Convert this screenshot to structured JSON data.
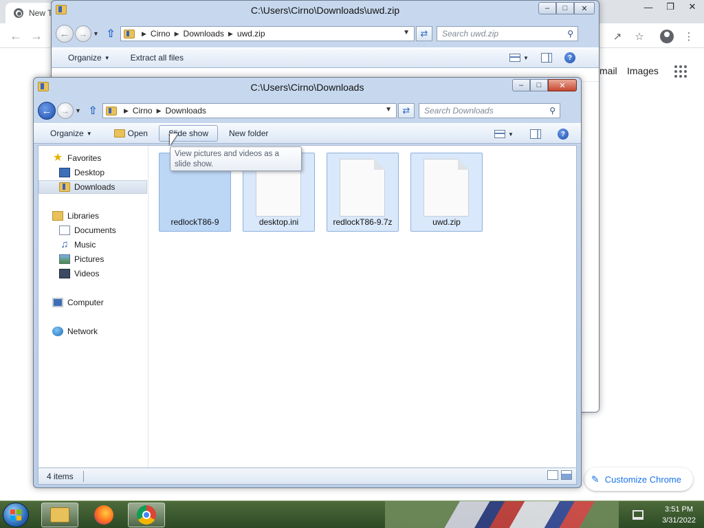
{
  "chrome": {
    "tab_title": "New T",
    "links": [
      "mail",
      "Images"
    ],
    "customize_label": "Customize Chrome"
  },
  "back_window": {
    "title": "C:\\Users\\Cirno\\Downloads\\uwd.zip",
    "breadcrumb": [
      "Cirno",
      "Downloads",
      "uwd.zip"
    ],
    "search_placeholder": "Search uwd.zip",
    "commands": {
      "organize": "Organize",
      "extract": "Extract all files"
    }
  },
  "front_window": {
    "title": "C:\\Users\\Cirno\\Downloads",
    "breadcrumb": [
      "Cirno",
      "Downloads"
    ],
    "search_placeholder": "Search Downloads",
    "commands": {
      "organize": "Organize",
      "open": "Open",
      "slideshow": "Slide show",
      "new_folder": "New folder"
    },
    "nav": {
      "favorites": "Favorites",
      "desktop": "Desktop",
      "downloads": "Downloads",
      "libraries": "Libraries",
      "documents": "Documents",
      "music": "Music",
      "pictures": "Pictures",
      "videos": "Videos",
      "computer": "Computer",
      "network": "Network"
    },
    "files": [
      "redlockT86-9",
      "desktop.ini",
      "redlockT86-9.7z",
      "uwd.zip"
    ],
    "tooltip": "View pictures and videos as a slide show.",
    "status": "4 items"
  },
  "taskbar": {
    "time": "3:51 PM",
    "date": "3/31/2022"
  }
}
